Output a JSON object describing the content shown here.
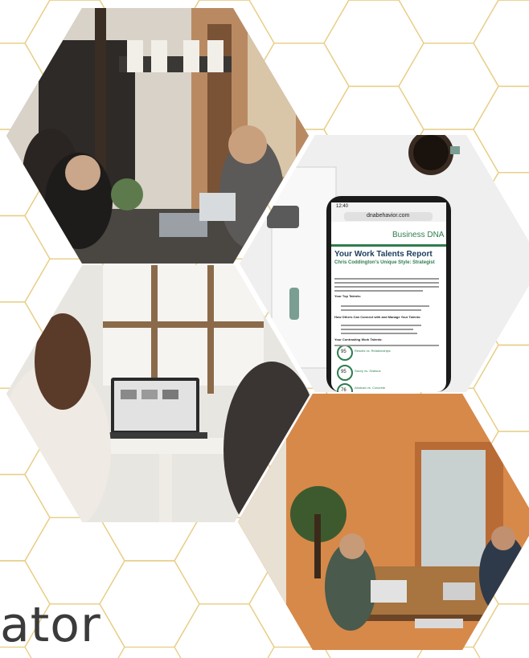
{
  "background": {
    "pattern": "gold-hexagon-lattice",
    "line_color": "#e8cf8a"
  },
  "photos": [
    {
      "name": "office-meeting-photo"
    },
    {
      "name": "phone-report-photo"
    },
    {
      "name": "laptop-desk-photo"
    },
    {
      "name": "coworking-orange-wall-photo"
    }
  ],
  "phone": {
    "status_time": "12:40",
    "url": "dnabehavior.com",
    "brand": "Business DNA",
    "report_title": "Your Work Talents Report",
    "report_subtitle": "Chris Coddington's Unique Style: Strategist",
    "sections": [
      "Your Top Talents:",
      "How Others Can Connect with and Manage Your Talents:",
      "Your Contrasting Work Talents:"
    ],
    "scores": [
      {
        "value": "95",
        "label": "Results vs. Relationships"
      },
      {
        "value": "95",
        "label": "Savvy vs. Zealous"
      },
      {
        "value": "76",
        "label": "Abstract vs. Concrete"
      }
    ]
  },
  "bottom_text": "ator"
}
